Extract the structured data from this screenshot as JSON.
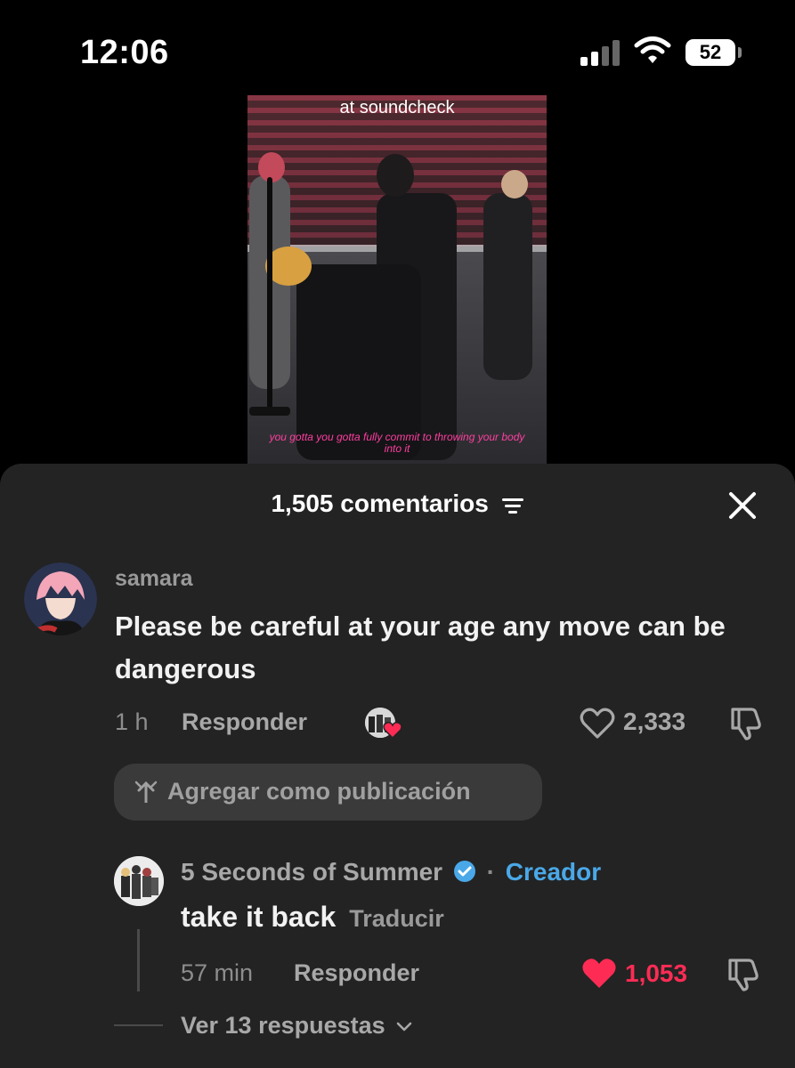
{
  "status_bar": {
    "time": "12:06",
    "battery": "52"
  },
  "video": {
    "caption_top": "at soundcheck",
    "caption_bottom": "you gotta you gotta fully commit to throwing your body into it"
  },
  "sheet": {
    "title": "1,505 comentarios"
  },
  "comment": {
    "username": "samara",
    "text": "Please be careful at your age any move can be dangerous",
    "time": "1 h",
    "reply_label": "Responder",
    "likes": "2,333",
    "add_post_label": "Agregar como publicación"
  },
  "reply": {
    "username": "5 Seconds of Summer",
    "creator_label": "Creador",
    "text": "take it back",
    "translate_label": "Traducir",
    "time": "57 min",
    "reply_label": "Responder",
    "likes": "1,053",
    "liked": true,
    "view_replies": "Ver 13 respuestas"
  },
  "colors": {
    "like_red": "#fe2c55",
    "verified_blue": "#4aa8e8",
    "sheet_bg": "#232323"
  }
}
